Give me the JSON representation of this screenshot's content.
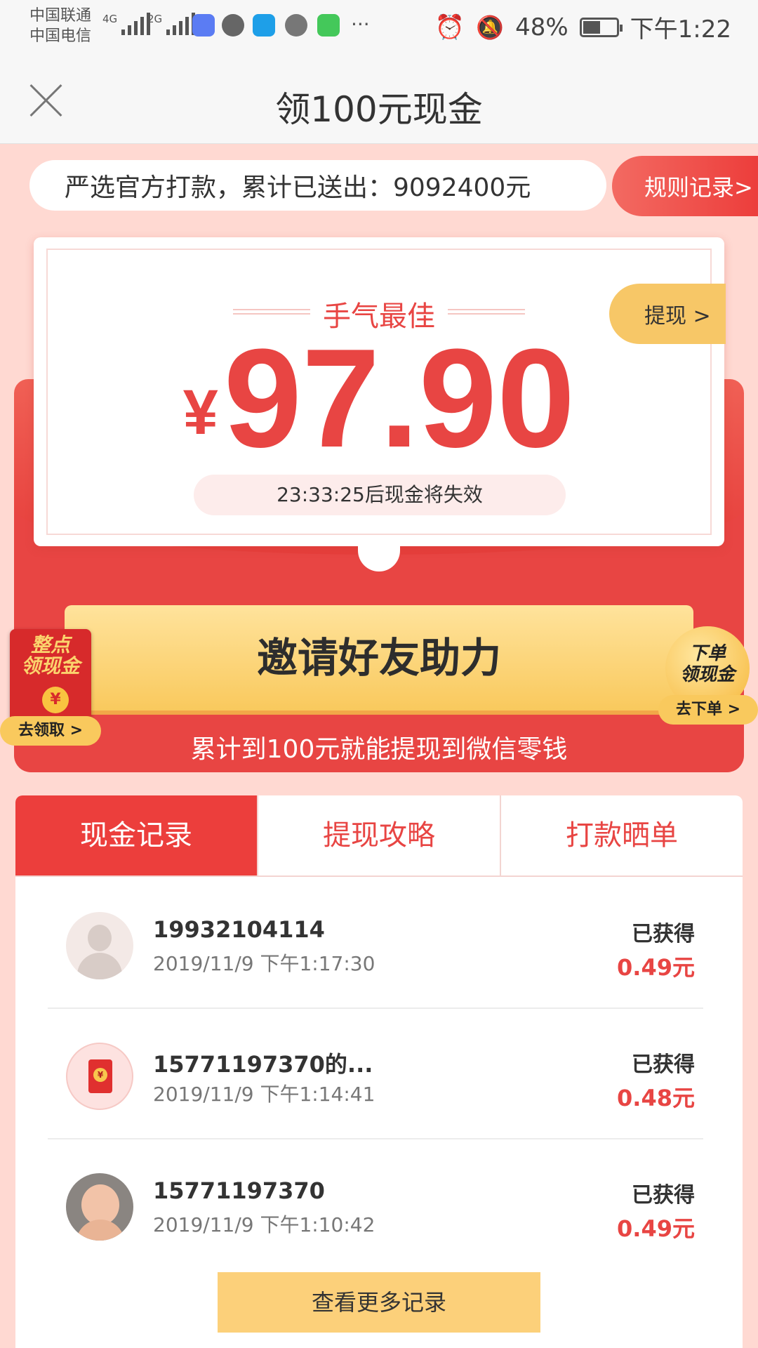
{
  "status_bar": {
    "carrier1": "中国联通",
    "carrier2": "中国电信",
    "sig1_type": "4G",
    "sig2_type": "2G",
    "more": "···",
    "battery": "48%",
    "time": "下午1:22"
  },
  "nav": {
    "title": "领100元现金"
  },
  "ticker": {
    "text": "严选官方打款，累计已送出：9092400元"
  },
  "rules_button": "规则记录>",
  "card": {
    "best_luck": "手气最佳",
    "currency": "¥",
    "amount": "97.90",
    "expiry": "23:33:25后现金将失效",
    "withdraw": "提现 >"
  },
  "invite": {
    "button": "邀请好友助力",
    "subtitle": "累计到100元就能提现到微信零钱"
  },
  "float_left": {
    "title_line1": "整点",
    "title_line2": "领现金",
    "coin": "¥",
    "button": "去领取 >"
  },
  "float_right": {
    "title_line1": "下单",
    "title_line2": "领现金",
    "button": "去下单 >"
  },
  "tabs": [
    {
      "label": "现金记录",
      "active": true
    },
    {
      "label": "提现攻略",
      "active": false
    },
    {
      "label": "打款晒单",
      "active": false
    }
  ],
  "records": [
    {
      "name": "19932104114",
      "time": "2019/11/9 下午1:17:30",
      "label": "已获得",
      "amount": "0.49元"
    },
    {
      "name": "15771197370的...",
      "time": "2019/11/9 下午1:14:41",
      "label": "已获得",
      "amount": "0.48元"
    },
    {
      "name": "15771197370",
      "time": "2019/11/9 下午1:10:42",
      "label": "已获得",
      "amount": "0.49元"
    }
  ],
  "more_button": "查看更多记录",
  "colors": {
    "accent_red": "#e84543",
    "gold": "#f9c95d",
    "page_bg": "#ffd9d2"
  }
}
